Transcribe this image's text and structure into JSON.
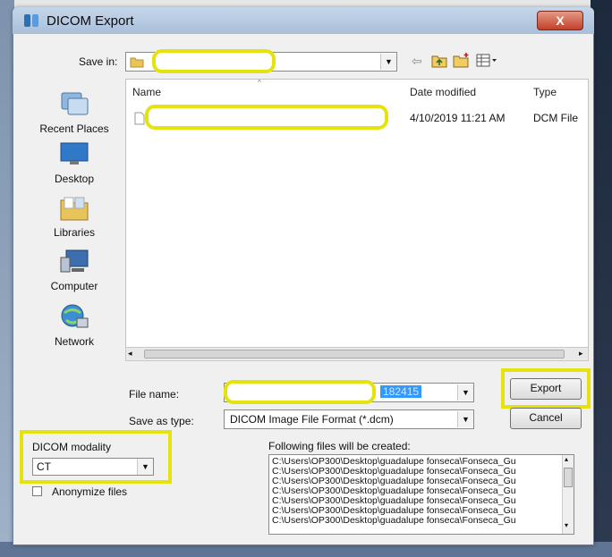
{
  "window": {
    "title": "DICOM Export",
    "close_label": "X"
  },
  "save_in": {
    "label": "Save in:",
    "value": "",
    "toolbar_icons": [
      "back-icon",
      "up-folder-icon",
      "new-folder-icon",
      "views-menu-icon"
    ]
  },
  "places": [
    {
      "label": "Recent Places",
      "icon": "recent-places-icon"
    },
    {
      "label": "Desktop",
      "icon": "desktop-icon"
    },
    {
      "label": "Libraries",
      "icon": "libraries-icon"
    },
    {
      "label": "Computer",
      "icon": "computer-icon"
    },
    {
      "label": "Network",
      "icon": "network-icon"
    }
  ],
  "columns": {
    "name": "Name",
    "date_modified": "Date modified",
    "type": "Type"
  },
  "files": [
    {
      "name": "",
      "date_modified": "4/10/2019 11:21 AM",
      "type": "DCM File"
    }
  ],
  "file_name": {
    "label": "File name:",
    "value": "182415"
  },
  "save_as_type": {
    "label": "Save as type:",
    "value": "DICOM Image File Format (*.dcm)"
  },
  "buttons": {
    "export": "Export",
    "cancel": "Cancel"
  },
  "dicom_modality": {
    "label": "DICOM modality",
    "value": "CT"
  },
  "anonymize": {
    "label": "Anonymize files",
    "checked": false
  },
  "following_files": {
    "label": "Following files will be created:",
    "items": [
      "C:\\Users\\OP300\\Desktop\\guadalupe fonseca\\Fonseca_Gu",
      "C:\\Users\\OP300\\Desktop\\guadalupe fonseca\\Fonseca_Gu",
      "C:\\Users\\OP300\\Desktop\\guadalupe fonseca\\Fonseca_Gu",
      "C:\\Users\\OP300\\Desktop\\guadalupe fonseca\\Fonseca_Gu",
      "C:\\Users\\OP300\\Desktop\\guadalupe fonseca\\Fonseca_Gu",
      "C:\\Users\\OP300\\Desktop\\guadalupe fonseca\\Fonseca_Gu",
      "C:\\Users\\OP300\\Desktop\\guadalupe fonseca\\Fonseca_Gu"
    ]
  },
  "colors": {
    "highlight": "#e6e20d",
    "selection": "#3399ff"
  }
}
